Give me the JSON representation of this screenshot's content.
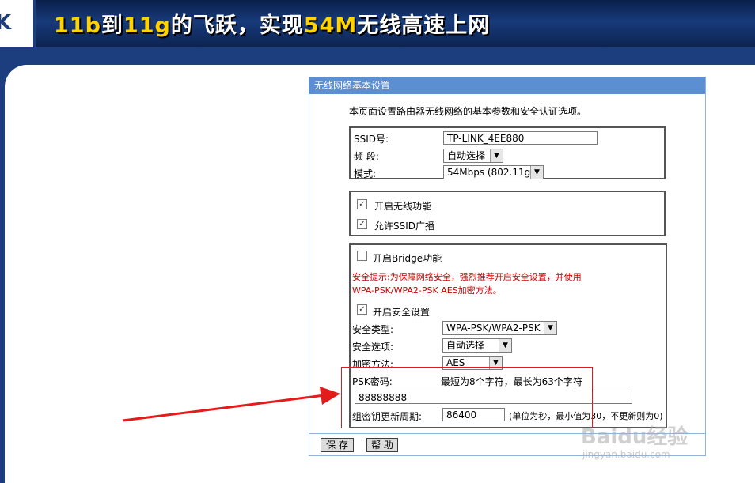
{
  "banner": {
    "logo_fragment": "K",
    "title_parts": [
      "11b",
      "到",
      "11g",
      "的飞跃，实现",
      "54M",
      "无线高速上网"
    ]
  },
  "panel": {
    "title": "无线网络基本设置",
    "intro": "本页面设置路由器无线网络的基本参数和安全认证选项。",
    "basic": {
      "ssid_label": "SSID号:",
      "ssid_value": "TP-LINK_4EE880",
      "band_label": "频 段:",
      "band_value": "自动选择",
      "mode_label": "模式:",
      "mode_value": "54Mbps (802.11g)"
    },
    "wireless": {
      "enable_label": "开启无线功能",
      "enable_checked": true,
      "broadcast_label": "允许SSID广播",
      "broadcast_checked": true
    },
    "security": {
      "bridge_label": "开启Bridge功能",
      "bridge_checked": false,
      "warning_line1": "安全提示:为保障网络安全，强烈推荐开启安全设置，并使用",
      "warning_line2": "WPA-PSK/WPA2-PSK AES加密方法。",
      "enable_label": "开启安全设置",
      "enable_checked": true,
      "type_label": "安全类型:",
      "type_value": "WPA-PSK/WPA2-PSK",
      "option_label": "安全选项:",
      "option_value": "自动选择",
      "encrypt_label": "加密方法:",
      "encrypt_value": "AES",
      "psk_label": "PSK密码:",
      "psk_hint": "最短为8个字符，最长为63个字符",
      "psk_value": "88888888",
      "rekey_label": "组密钥更新周期:",
      "rekey_value": "86400",
      "rekey_hint": "(单位为秒，最小值为30，不更新则为0)"
    },
    "buttons": {
      "save": "保 存",
      "help": "帮 助"
    }
  },
  "watermark": {
    "brand": "Baidu经验",
    "url": "jingyan.baidu.com"
  },
  "colors": {
    "header": "#5b8fd2",
    "banner": "#1d3e7e",
    "warning": "#cc0000",
    "highlight": "#d81e1e"
  }
}
